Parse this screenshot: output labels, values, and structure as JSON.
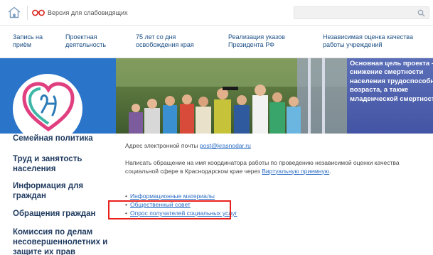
{
  "topbar": {
    "vi_label": "Версия для слабовидящих",
    "search_placeholder": ""
  },
  "nav": {
    "items": [
      {
        "label": "Запись на\nприём"
      },
      {
        "label": "Проектная\nдеятельность"
      },
      {
        "label": "75 лет со дня\nосвобождения края"
      },
      {
        "label": "Реализация указов\nПрезидента РФ"
      },
      {
        "label": "Независимая оценка качества\nработы учреждений"
      }
    ]
  },
  "banner": {
    "text": "Основная цель проекта -\nснижение смертности\nнаселения трудоспособного\nвозраста, а также\nмладенческой смертности"
  },
  "sidebar": {
    "items": [
      {
        "label": "Семейная политика"
      },
      {
        "label": "Труд и занятость населения"
      },
      {
        "label": "Информация для граждан"
      },
      {
        "label": "Обращения граждан"
      },
      {
        "label": "Комиссия по делам несовершеннолетних и защите их прав"
      }
    ]
  },
  "main": {
    "email_prefix": "Адрес электронной почты",
    "email": "post@krasnodar.ru",
    "appeal_text": "Написать обращение на имя координатора работы по проведению независимой оценки качества социальной сфере в Краснодарском крае через",
    "appeal_link": "Виртуальную приемную",
    "appeal_suffix": ".",
    "links": [
      {
        "label": "Информационные материалы"
      },
      {
        "label": "Общественный совет"
      },
      {
        "label": "Опрос получателей социальных услуг"
      }
    ]
  },
  "colors": {
    "accent": "#2a74c9",
    "link": "#2a6cc4",
    "highlight": "#e8201c"
  }
}
